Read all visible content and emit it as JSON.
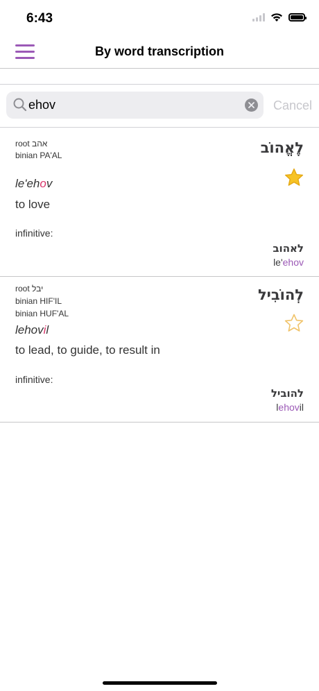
{
  "status_bar": {
    "time": "6:43"
  },
  "nav": {
    "title": "By word transcription"
  },
  "search": {
    "value": "ehov",
    "cancel_label": "Cancel"
  },
  "entries": [
    {
      "root": "root אהב",
      "binian": [
        "binian PA'AL"
      ],
      "hebrew": "לֶאֱהוֹב",
      "favorite": true,
      "transcription_pre": "le'eh",
      "transcription_accent": "o",
      "transcription_post": "v",
      "meaning": "to love",
      "infinitive_label": "infinitive:",
      "infinitive_hebrew": "לאהוב",
      "infinitive_pre": "le'",
      "infinitive_hl": "ehov",
      "infinitive_post": ""
    },
    {
      "root": "root יבל",
      "binian": [
        "binian HIF'IL",
        "binian HUF'AL"
      ],
      "hebrew": "לְהוֹבִיל",
      "favorite": false,
      "transcription_pre": "lehov",
      "transcription_accent": "i",
      "transcription_post": "l",
      "meaning": "to lead, to guide, to result in",
      "infinitive_label": "infinitive:",
      "infinitive_hebrew": "להוביל",
      "infinitive_pre": "l",
      "infinitive_hl": "ehov",
      "infinitive_post": "il"
    }
  ],
  "colors": {
    "accent": "#9b59b6",
    "star_fill": "#f7c325",
    "highlight": "#d9366b"
  },
  "icons": {
    "menu": "hamburger-menu-icon",
    "search": "search-icon",
    "clear": "clear-icon",
    "star_filled": "star-filled-icon",
    "star_outline": "star-outline-icon"
  }
}
